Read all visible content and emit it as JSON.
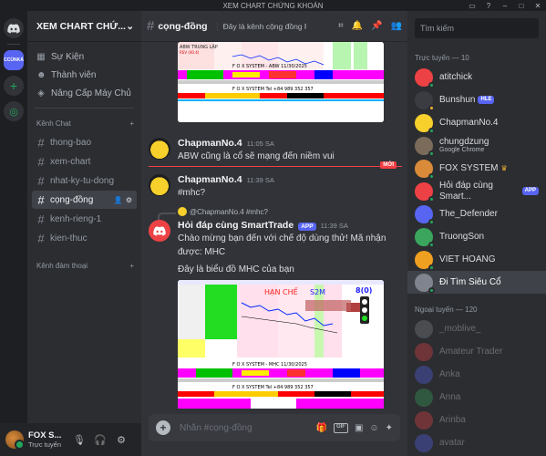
{
  "window": {
    "title": "XEM CHART CHỨNG KHOÁN"
  },
  "rail": {
    "active_label": "CCÙNKÁ"
  },
  "sidebar": {
    "server_name": "XEM CHART CHỨ...",
    "links": [
      {
        "label": "Sự Kiện",
        "icon": "calendar-icon"
      },
      {
        "label": "Thành viên",
        "icon": "members-icon"
      },
      {
        "label": "Nâng Cấp Máy Chủ",
        "icon": "boost-icon"
      }
    ],
    "categories": [
      {
        "label": "Kênh Chat",
        "channels": [
          "thong-bao",
          "xem-chart",
          "nhat-ky-tu-dong",
          "cọng-đồng",
          "kenh-rieng-1",
          "kien-thuc"
        ]
      },
      {
        "label": "Kênh đàm thoại",
        "channels": []
      }
    ],
    "active_channel": "cọng-đồng"
  },
  "user_panel": {
    "name": "FOX S...",
    "status": "Trực tuyến"
  },
  "header": {
    "channel": "cọng-đồng",
    "topic": "Đây là kênh cộng đồng Phước..."
  },
  "messages": [
    {
      "author": "ChapmanNo.4",
      "time": "11:05 SA",
      "text": "ABW cũng là cổ sẽ mạng đến niềm vui"
    },
    {
      "author": "ChapmanNo.4",
      "time": "11:39 SA",
      "text": "#mhc?"
    },
    {
      "reply_to": "@ChapmanNo.4 #mhc?",
      "author": "Hỏi đáp cùng SmartTrade",
      "badge": "APP",
      "time": "11:39 SA",
      "lines": [
        "Chào mừng bạn đến với chế độ dùng thử! Mã nhận",
        "được: MHC",
        "Đây là biểu đồ MHC của bạn"
      ]
    }
  ],
  "new_badge": "MỚI",
  "chart_top": {
    "caption": "F O X SYSTEM - ABW 11/30/2025",
    "label1": "ABW TRUNG LẬP",
    "label2": "RSV (40.4)",
    "footer": "F O X SYSTEM Tel +84 989 352 357"
  },
  "chart_bottom": {
    "caption": "F O X SYSTEM - MHC 11/30/2025",
    "han_che": "HẠN CHẾ",
    "s2m": "S2M",
    "score": "8(0)",
    "footer": "F O X SYSTEM Tel +84 989 352 357"
  },
  "input": {
    "placeholder": "Nhắn #cọng-đồng"
  },
  "members": {
    "search_placeholder": "Tìm kiếm",
    "online_header": "Trực tuyến — 10",
    "online": [
      {
        "name": "atitchick",
        "color": "#ed4245",
        "status": "online"
      },
      {
        "name": "Bunshun",
        "color": "#3a3c42",
        "status": "idle",
        "tag": "HLE"
      },
      {
        "name": "ChapmanNo.4",
        "color": "#f7d02c",
        "status": "online"
      },
      {
        "name": "chungdzung",
        "color": "#7a6b5a",
        "status": "online",
        "sub": "Google Chrome"
      },
      {
        "name": "FOX SYSTEM",
        "color": "#d98b3a",
        "status": "online",
        "crown": "♛"
      },
      {
        "name": "Hỏi đáp cùng Smart...",
        "color": "#ed4245",
        "status": "online",
        "tag": "APP"
      },
      {
        "name": "The_Defender",
        "color": "#5865f2",
        "status": "online"
      },
      {
        "name": "TruongSon",
        "color": "#3ba55d",
        "status": "online"
      },
      {
        "name": "VIET HOANG",
        "color": "#f0a020",
        "status": "online"
      },
      {
        "name": "Đi Tìm Siêu Cổ",
        "color": "#80848e",
        "status": "online"
      }
    ],
    "offline_header": "Ngoại tuyến — 120",
    "offline": [
      {
        "name": "_moblive_",
        "color": "#888"
      },
      {
        "name": "Amateur Trader",
        "color": "#ed4245"
      },
      {
        "name": "Anka",
        "color": "#5865f2"
      },
      {
        "name": "Anna",
        "color": "#3ba55d"
      },
      {
        "name": "Arinba",
        "color": "#ed4245"
      },
      {
        "name": "avatar",
        "color": "#5865f2"
      }
    ]
  }
}
